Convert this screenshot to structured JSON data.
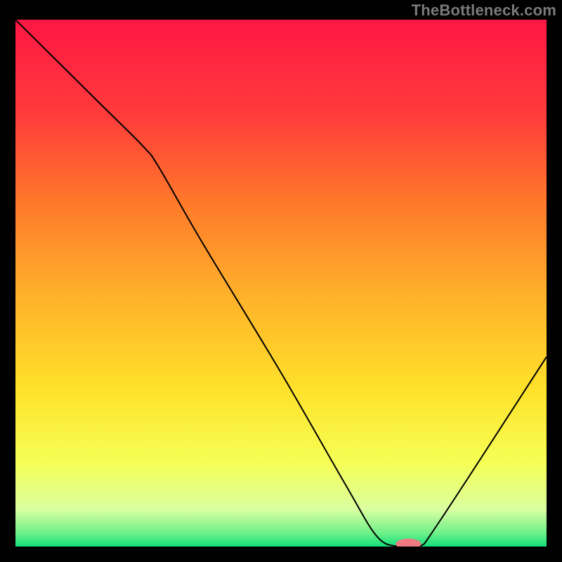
{
  "watermark": "TheBottleneck.com",
  "chart_data": {
    "type": "line",
    "title": "",
    "xlabel": "",
    "ylabel": "",
    "xlim": [
      0,
      100
    ],
    "ylim": [
      0,
      100
    ],
    "grid": false,
    "legend": false,
    "background_gradient": {
      "stops": [
        {
          "offset": 0.0,
          "color": "#ff1744"
        },
        {
          "offset": 0.18,
          "color": "#ff3b3b"
        },
        {
          "offset": 0.35,
          "color": "#ff7a2a"
        },
        {
          "offset": 0.52,
          "color": "#ffb02a"
        },
        {
          "offset": 0.7,
          "color": "#ffe12a"
        },
        {
          "offset": 0.84,
          "color": "#f6ff55"
        },
        {
          "offset": 0.93,
          "color": "#d9ffa0"
        },
        {
          "offset": 0.975,
          "color": "#6df08a"
        },
        {
          "offset": 1.0,
          "color": "#12e07a"
        }
      ]
    },
    "series": [
      {
        "name": "bottleneck-curve",
        "color": "#000000",
        "width": 2,
        "x": [
          0,
          8,
          16,
          24,
          27,
          35,
          50,
          62,
          68,
          72,
          76,
          80,
          100
        ],
        "y": [
          100,
          92,
          84,
          76,
          72,
          58,
          33,
          12,
          2,
          0,
          0,
          5,
          36
        ]
      }
    ],
    "marker": {
      "name": "highlight-marker",
      "x": 74,
      "y": 0.5,
      "rx": 2.4,
      "ry": 1.0,
      "color": "#ef7a82"
    }
  }
}
